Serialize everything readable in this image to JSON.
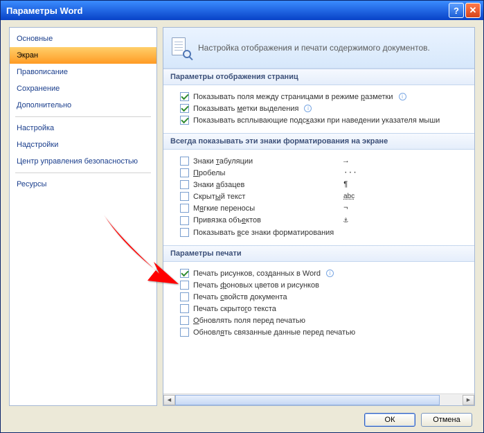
{
  "window": {
    "title": "Параметры Word"
  },
  "sidebar": {
    "items": [
      {
        "label": "Основные"
      },
      {
        "label": "Экран"
      },
      {
        "label": "Правописание"
      },
      {
        "label": "Сохранение"
      },
      {
        "label": "Дополнительно"
      },
      {
        "label": "Настройка"
      },
      {
        "label": "Надстройки"
      },
      {
        "label": "Центр управления безопасностью"
      },
      {
        "label": "Ресурсы"
      }
    ],
    "selected_index": 1
  },
  "header": {
    "text": "Настройка отображения и печати содержимого документов."
  },
  "sections": {
    "display": {
      "title": "Параметры отображения страниц",
      "items": [
        {
          "label_pre": "Показывать поля между страницами в режиме ",
          "u": "р",
          "label_post": "азметки",
          "checked": true,
          "info": true
        },
        {
          "label_pre": "Показывать ",
          "u": "м",
          "label_post": "етки выделения",
          "checked": true,
          "info": true
        },
        {
          "label_pre": "Показывать всплывающие подс",
          "u": "к",
          "label_post": "азки при наведении указателя мыши",
          "checked": true,
          "info": false
        }
      ]
    },
    "marks": {
      "title": "Всегда показывать эти знаки форматирования на экране",
      "items": [
        {
          "label_pre": "Знаки ",
          "u": "т",
          "label_post": "абуляции",
          "symbol": "→"
        },
        {
          "label_pre": "",
          "u": "П",
          "label_post": "робелы",
          "symbol": "···"
        },
        {
          "label_pre": "Знаки ",
          "u": "а",
          "label_post": "бзацев",
          "symbol": "¶"
        },
        {
          "label_pre": "Скрыт",
          "u": "ы",
          "label_post": "й текст",
          "symbol": "abc"
        },
        {
          "label_pre": "М",
          "u": "я",
          "label_post": "гкие переносы",
          "symbol": "¬"
        },
        {
          "label_pre": "Привязка объ",
          "u": "е",
          "label_post": "ктов",
          "symbol": "⚓"
        },
        {
          "label_pre": "Показывать ",
          "u": "в",
          "label_post": "се знаки форматирования",
          "symbol": ""
        }
      ]
    },
    "print": {
      "title": "Параметры печати",
      "items": [
        {
          "label_pre": "Печать рисунков, соз",
          "u": "д",
          "label_post": "анных в Word",
          "checked": true,
          "info": true
        },
        {
          "label_pre": "Печать ",
          "u": "ф",
          "label_post": "оновых цветов и рисунков",
          "checked": false,
          "info": false
        },
        {
          "label_pre": "Печать ",
          "u": "с",
          "label_post": "войств документа",
          "checked": false,
          "info": false
        },
        {
          "label_pre": "Печать скрыто",
          "u": "г",
          "label_post": "о текста",
          "checked": false,
          "info": false
        },
        {
          "label_pre": "",
          "u": "О",
          "label_post": "бновлять поля перед печатью",
          "checked": false,
          "info": false
        },
        {
          "label_pre": "Обновл",
          "u": "я",
          "label_post": "ть связанные данные перед печатью",
          "checked": false,
          "info": false
        }
      ]
    }
  },
  "buttons": {
    "ok": "ОК",
    "cancel": "Отмена"
  }
}
